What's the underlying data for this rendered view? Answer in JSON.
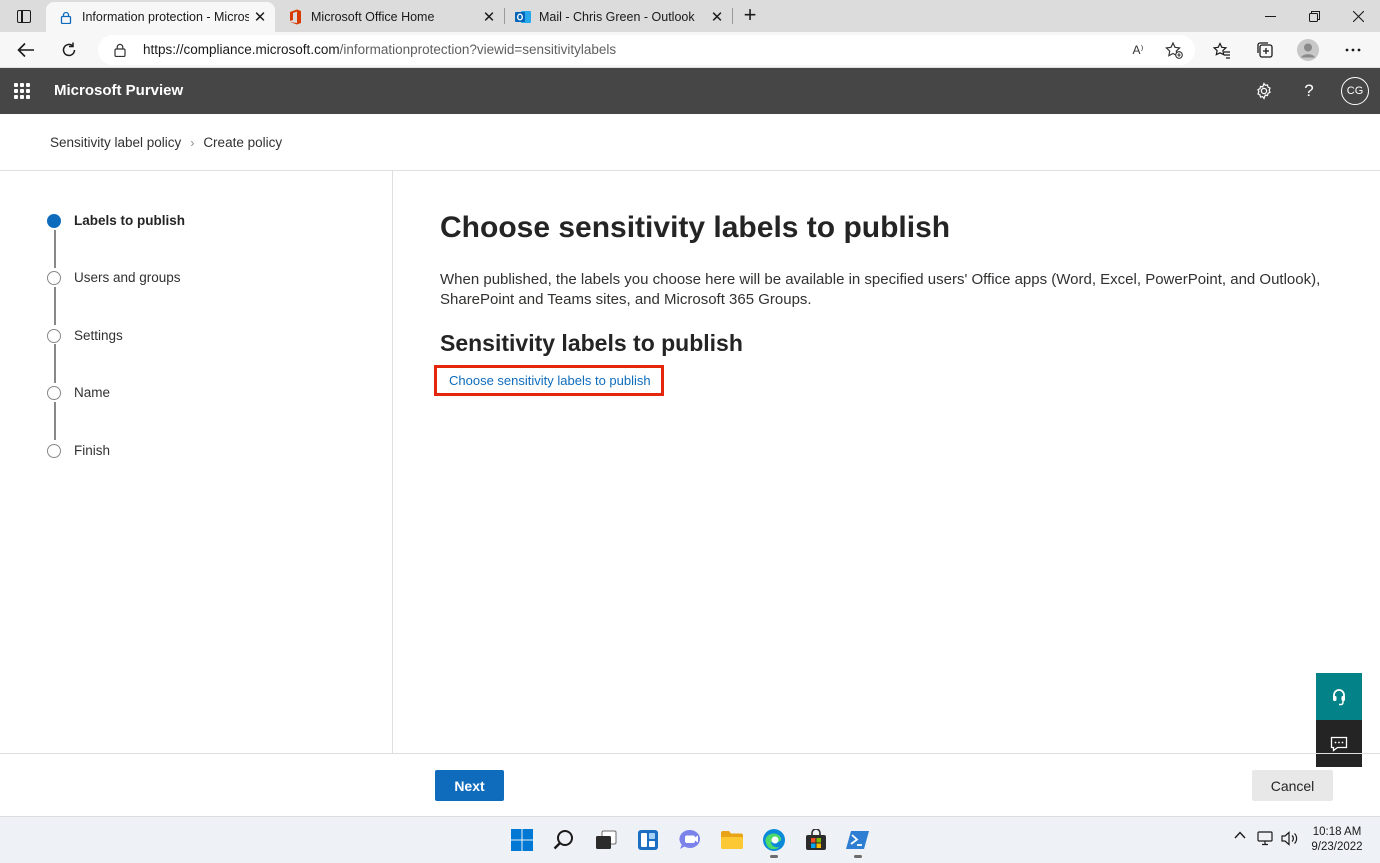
{
  "browser": {
    "tabs": [
      {
        "title": "Information protection - Microso",
        "active": true,
        "favicon": "lock-icon"
      },
      {
        "title": "Microsoft Office Home",
        "active": false,
        "favicon": "office-icon"
      },
      {
        "title": "Mail - Chris Green - Outlook",
        "active": false,
        "favicon": "outlook-icon"
      }
    ],
    "url_host": "https://compliance.microsoft.com",
    "url_path": "/informationprotection?viewid=sensitivitylabels",
    "read_aloud": "A⁾"
  },
  "app": {
    "title": "Microsoft Purview",
    "user_initials": "CG"
  },
  "breadcrumb": {
    "parent": "Sensitivity label policy",
    "current": "Create policy"
  },
  "steps": [
    {
      "label": "Labels to publish",
      "active": true
    },
    {
      "label": "Users and groups",
      "active": false
    },
    {
      "label": "Settings",
      "active": false
    },
    {
      "label": "Name",
      "active": false
    },
    {
      "label": "Finish",
      "active": false
    }
  ],
  "main": {
    "heading": "Choose sensitivity labels to publish",
    "description": "When published, the labels you choose here will be available in specified users' Office apps (Word, Excel, PowerPoint, and Outlook), SharePoint and Teams sites, and Microsoft 365 Groups.",
    "subheading": "Sensitivity labels to publish",
    "choose_link": "Choose sensitivity labels to publish"
  },
  "footer": {
    "next_label": "Next",
    "cancel_label": "Cancel"
  },
  "taskbar": {
    "time": "10:18 AM",
    "date": "9/23/2022"
  },
  "colors": {
    "accent": "#0f6cbd",
    "header_bg": "#464646",
    "highlight_border": "#e4260c",
    "help_button": "#038387"
  }
}
